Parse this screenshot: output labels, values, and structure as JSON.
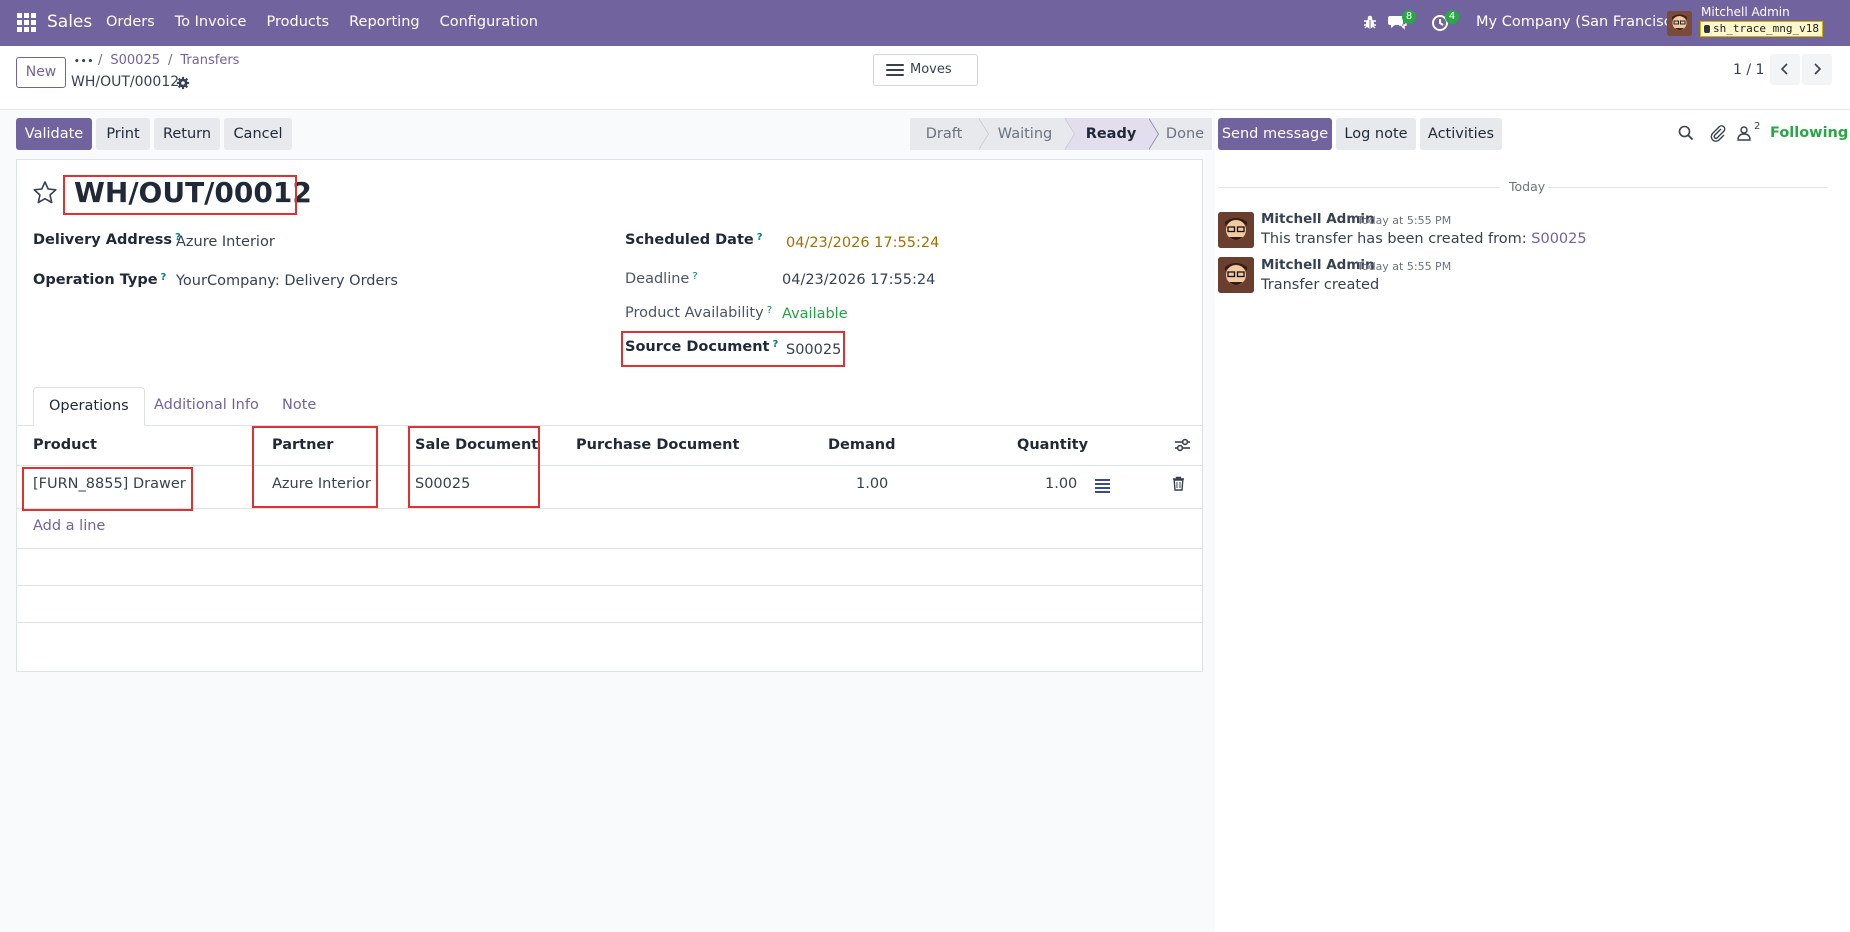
{
  "navbar": {
    "brand": "Sales",
    "menu": [
      "Orders",
      "To Invoice",
      "Products",
      "Reporting",
      "Configuration"
    ],
    "chat_badge": "8",
    "activity_badge": "4",
    "company": "My Company (San Francisco)",
    "user_name": "Mitchell Admin",
    "db_name": "sh_trace_mng_v18"
  },
  "control": {
    "new_label": "New",
    "breadcrumb_dots": "•••",
    "breadcrumbs": [
      "S00025",
      "Transfers"
    ],
    "record_name": "WH/OUT/00012",
    "moves_label": "Moves",
    "pager": "1 / 1"
  },
  "actions": {
    "validate": "Validate",
    "print": "Print",
    "return": "Return",
    "cancel": "Cancel"
  },
  "statusbar": {
    "stages": [
      "Draft",
      "Waiting",
      "Ready",
      "Done"
    ],
    "active": "Ready"
  },
  "form": {
    "title": "WH/OUT/00012",
    "delivery_address_label": "Delivery Address",
    "delivery_address": "Azure Interior",
    "operation_type_label": "Operation Type",
    "operation_type": "YourCompany: Delivery Orders",
    "scheduled_date_label": "Scheduled Date",
    "scheduled_date": "04/23/2026 17:55:24",
    "deadline_label": "Deadline",
    "deadline": "04/23/2026 17:55:24",
    "availability_label": "Product Availability",
    "availability": "Available",
    "source_document_label": "Source Document",
    "source_document": "S00025",
    "help_mark": "?"
  },
  "tabs": [
    "Operations",
    "Additional Info",
    "Note"
  ],
  "operations": {
    "columns": [
      "Product",
      "Partner",
      "Sale Document",
      "Purchase Document",
      "Demand",
      "Quantity"
    ],
    "rows": [
      {
        "product": "[FURN_8855] Drawer",
        "partner": "Azure Interior",
        "sale_document": "S00025",
        "purchase_document": "",
        "demand": "1.00",
        "quantity": "1.00"
      }
    ],
    "add_line": "Add a line"
  },
  "chatter": {
    "send_message": "Send message",
    "log_note": "Log note",
    "activities": "Activities",
    "followers_count": "2",
    "following": "Following",
    "date_separator": "Today",
    "messages": [
      {
        "author": "Mitchell Admin",
        "time": "Today at 5:55 PM",
        "body": "This transfer has been created from:",
        "link": "S00025"
      },
      {
        "author": "Mitchell Admin",
        "time": "Today at 5:55 PM",
        "body": "Transfer created",
        "link": ""
      }
    ]
  },
  "colors": {
    "brand": "#71639e",
    "highlight_box": "#e03030",
    "available": "#24a148",
    "deadline_warning": "#a07000"
  }
}
